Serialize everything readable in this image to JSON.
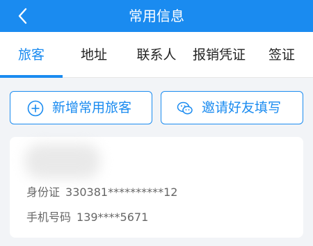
{
  "header": {
    "title": "常用信息",
    "accent_color": "#1a8bf0"
  },
  "tabs": [
    {
      "label": "旅客",
      "active": true
    },
    {
      "label": "地址",
      "active": false
    },
    {
      "label": "联系人",
      "active": false
    },
    {
      "label": "报销凭证",
      "active": false
    },
    {
      "label": "签证",
      "active": false
    }
  ],
  "actions": {
    "add_label": "新增常用旅客",
    "add_icon": "plus-circle-icon",
    "invite_label": "邀请好友填写",
    "invite_icon": "wechat-icon"
  },
  "passenger": {
    "id_label": "身份证",
    "id_value": "330381**********12",
    "phone_label": "手机号码",
    "phone_value": "139****5671"
  }
}
